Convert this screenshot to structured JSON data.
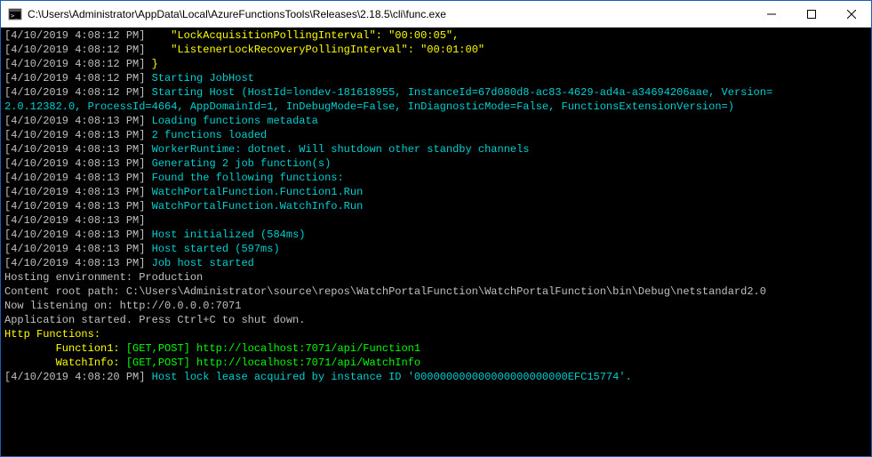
{
  "window": {
    "title": "C:\\Users\\Administrator\\AppData\\Local\\AzureFunctionsTools\\Releases\\2.18.5\\cli\\func.exe"
  },
  "lines": [
    {
      "ts": "[4/10/2019 4:08:12 PM] ",
      "parts": [
        {
          "c": "yellow",
          "t": "   \"LockAcquisitionPollingInterval\": \"00:00:05\","
        }
      ]
    },
    {
      "ts": "[4/10/2019 4:08:12 PM] ",
      "parts": [
        {
          "c": "yellow",
          "t": "   \"ListenerLockRecoveryPollingInterval\": \"00:01:00\""
        }
      ]
    },
    {
      "ts": "[4/10/2019 4:08:12 PM] ",
      "parts": [
        {
          "c": "yellow",
          "t": "}"
        }
      ]
    },
    {
      "ts": "[4/10/2019 4:08:12 PM] ",
      "parts": [
        {
          "c": "cyan",
          "t": "Starting JobHost"
        }
      ]
    },
    {
      "ts": "[4/10/2019 4:08:12 PM] ",
      "parts": [
        {
          "c": "cyan",
          "t": "Starting Host (HostId=londev-181618955, InstanceId=67d080d8-ac83-4629-ad4a-a34694206aae, Version="
        }
      ]
    },
    {
      "ts": "",
      "parts": [
        {
          "c": "cyan",
          "t": "2.0.12382.0, ProcessId=4664, AppDomainId=1, InDebugMode=False, InDiagnosticMode=False, FunctionsExtensionVersion=)"
        }
      ]
    },
    {
      "ts": "[4/10/2019 4:08:13 PM] ",
      "parts": [
        {
          "c": "cyan",
          "t": "Loading functions metadata"
        }
      ]
    },
    {
      "ts": "[4/10/2019 4:08:13 PM] ",
      "parts": [
        {
          "c": "cyan",
          "t": "2 functions loaded"
        }
      ]
    },
    {
      "ts": "[4/10/2019 4:08:13 PM] ",
      "parts": [
        {
          "c": "cyan",
          "t": "WorkerRuntime: dotnet. Will shutdown other standby channels"
        }
      ]
    },
    {
      "ts": "[4/10/2019 4:08:13 PM] ",
      "parts": [
        {
          "c": "cyan",
          "t": "Generating 2 job function(s)"
        }
      ]
    },
    {
      "ts": "[4/10/2019 4:08:13 PM] ",
      "parts": [
        {
          "c": "cyan",
          "t": "Found the following functions:"
        }
      ]
    },
    {
      "ts": "[4/10/2019 4:08:13 PM] ",
      "parts": [
        {
          "c": "cyan",
          "t": "WatchPortalFunction.Function1.Run"
        }
      ]
    },
    {
      "ts": "[4/10/2019 4:08:13 PM] ",
      "parts": [
        {
          "c": "cyan",
          "t": "WatchPortalFunction.WatchInfo.Run"
        }
      ]
    },
    {
      "ts": "[4/10/2019 4:08:13 PM] ",
      "parts": []
    },
    {
      "ts": "[4/10/2019 4:08:13 PM] ",
      "parts": [
        {
          "c": "cyan",
          "t": "Host initialized (584ms)"
        }
      ]
    },
    {
      "ts": "[4/10/2019 4:08:13 PM] ",
      "parts": [
        {
          "c": "cyan",
          "t": "Host started (597ms)"
        }
      ]
    },
    {
      "ts": "[4/10/2019 4:08:13 PM] ",
      "parts": [
        {
          "c": "cyan",
          "t": "Job host started"
        }
      ]
    },
    {
      "ts": "",
      "parts": [
        {
          "c": "white",
          "t": "Hosting environment: Production"
        }
      ]
    },
    {
      "ts": "",
      "parts": [
        {
          "c": "white",
          "t": "Content root path: C:\\Users\\Administrator\\source\\repos\\WatchPortalFunction\\WatchPortalFunction\\bin\\Debug\\netstandard2.0"
        }
      ]
    },
    {
      "ts": "",
      "parts": [
        {
          "c": "white",
          "t": "Now listening on: http://0.0.0.0:7071"
        }
      ]
    },
    {
      "ts": "",
      "parts": [
        {
          "c": "white",
          "t": "Application started. Press Ctrl+C to shut down."
        }
      ]
    },
    {
      "ts": "",
      "parts": []
    },
    {
      "ts": "",
      "parts": [
        {
          "c": "yellow",
          "t": "Http Functions:"
        }
      ]
    },
    {
      "ts": "",
      "parts": []
    },
    {
      "ts": "",
      "parts": [
        {
          "c": "yellow",
          "t": "        Function1: "
        },
        {
          "c": "green",
          "t": "[GET,POST] http://localhost:7071/api/Function1"
        }
      ]
    },
    {
      "ts": "",
      "parts": []
    },
    {
      "ts": "",
      "parts": [
        {
          "c": "yellow",
          "t": "        WatchInfo: "
        },
        {
          "c": "green",
          "t": "[GET,POST] http://localhost:7071/api/WatchInfo"
        }
      ]
    },
    {
      "ts": "",
      "parts": []
    },
    {
      "ts": "[4/10/2019 4:08:20 PM] ",
      "parts": [
        {
          "c": "cyan",
          "t": "Host lock lease acquired by instance ID '000000000000000000000000EFC15774'."
        }
      ]
    }
  ]
}
